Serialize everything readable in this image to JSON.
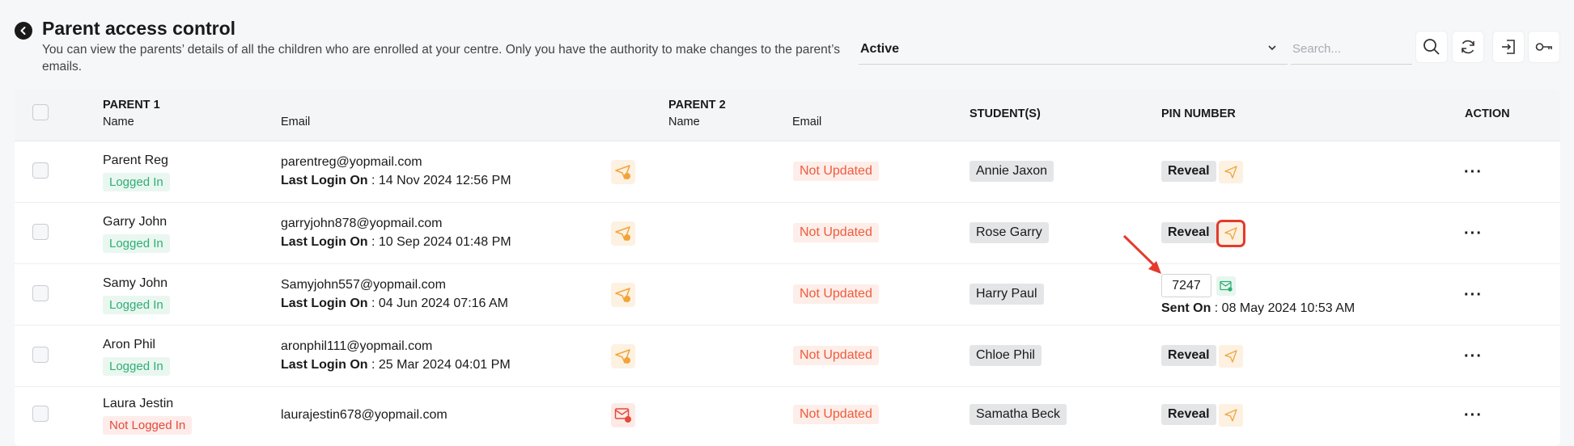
{
  "header": {
    "title": "Parent access control",
    "description": "You can view the parents’ details of all the children who are enrolled at your centre. Only you have the authority to make changes to the parent’s emails."
  },
  "filters": {
    "status_value": "Active",
    "search_placeholder": "Search..."
  },
  "table": {
    "parent1_header": "PARENT 1",
    "parent2_header": "PARENT 2",
    "name_sub": "Name",
    "email_sub": "Email",
    "students_header": "STUDENT(S)",
    "pin_header": "PIN NUMBER",
    "action_header": "ACTION",
    "last_login_label": "Last Login On",
    "sent_on_label": "Sent On",
    "reveal_label": "Reveal",
    "not_updated_label": "Not Updated",
    "action_glyph": "···",
    "rows": [
      {
        "name": "Parent Reg",
        "status": "Logged In",
        "email": "parentreg@yopmail.com",
        "last_login": " : 14 Nov 2024 12:56 PM",
        "student": "Annie Jaxon"
      },
      {
        "name": "Garry John",
        "status": "Logged In",
        "email": "garryjohn878@yopmail.com",
        "last_login": " : 10 Sep 2024 01:48 PM",
        "student": "Rose Garry"
      },
      {
        "name": "Samy John",
        "status": "Logged In",
        "email": "Samyjohn557@yopmail.com",
        "last_login": " : 04 Jun 2024 07:16 AM",
        "student": "Harry Paul",
        "pin": "7247",
        "sent_on": " : 08 May 2024 10:53 AM"
      },
      {
        "name": "Aron Phil",
        "status": "Logged In",
        "email": "aronphil111@yopmail.com",
        "last_login": " : 25 Mar 2024 04:01 PM",
        "student": "Chloe Phil"
      },
      {
        "name": "Laura Jestin",
        "status": "Not Logged In",
        "email": "laurajestin678@yopmail.com",
        "student": "Samatha Beck"
      }
    ]
  },
  "colors": {
    "accent_orange": "#f2a43a",
    "logged_in_green": "#2fae73",
    "error_red": "#e5493a",
    "annotation_red": "#e43a2c"
  }
}
